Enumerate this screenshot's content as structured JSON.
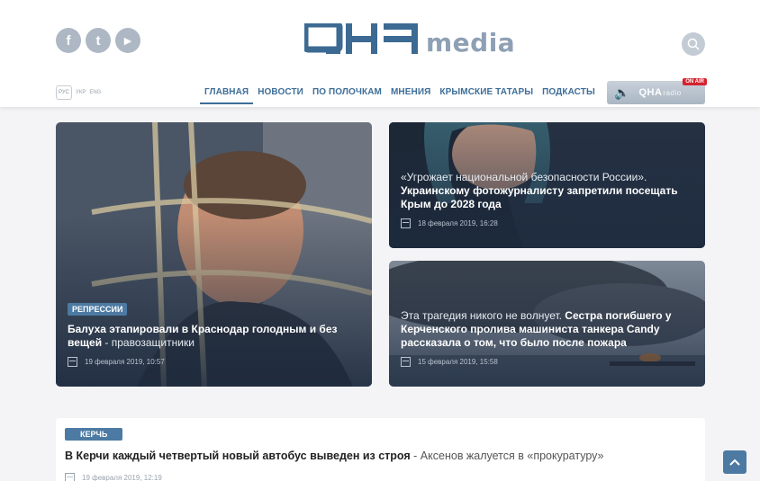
{
  "header": {
    "social": [
      {
        "icon": "facebook-icon",
        "glyph": "f"
      },
      {
        "icon": "twitter-icon",
        "glyph": "t"
      },
      {
        "icon": "youtube-icon",
        "glyph": "▶"
      }
    ],
    "logo_media": "media",
    "langs": [
      "РУС",
      "УКР",
      "ENG"
    ],
    "nav": [
      "ГЛАВНАЯ",
      "НОВОСТИ",
      "ПО ПОЛОЧКАМ",
      "МНЕНИЯ",
      "КРЫМСКИЕ ТАТАРЫ",
      "ПОДКАСТЫ"
    ],
    "radio": {
      "logo": "QHA",
      "sub": "radio",
      "badge": "ON AIR"
    }
  },
  "feature": {
    "tag": "РЕПРЕССИИ",
    "title_bold": "Балуха этапировали в Краснодар голодным и без вещей",
    "title_sub": " - правозащитники",
    "date": "19 февраля 2019, 10:57"
  },
  "side1": {
    "title_plain": "«Угрожает национальной безопасности России». ",
    "title_bold": "Украинскому фотожурналисту запретили посещать Крым до 2028 года",
    "date": "18 февраля 2019, 16:28"
  },
  "side2": {
    "title_plain": "Эта трагедия никого не волнует. ",
    "title_bold": "Сестра погибшего у Керченского пролива машиниста танкера Candy рассказала о том, что было после пожара",
    "date": "15 февраля 2019, 15:58"
  },
  "list": {
    "tag": "КЕРЧЬ",
    "title_bold": "В Керчи каждый четвертый новый автобус выведен из строя",
    "title_sub": " - Аксенов жалуется в «прокуратуру»",
    "date": "19 февраля 2019, 12:19"
  },
  "colors": {
    "accent": "#3e6e98",
    "tag": "#4c7aa3",
    "onair": "#d6232e"
  }
}
